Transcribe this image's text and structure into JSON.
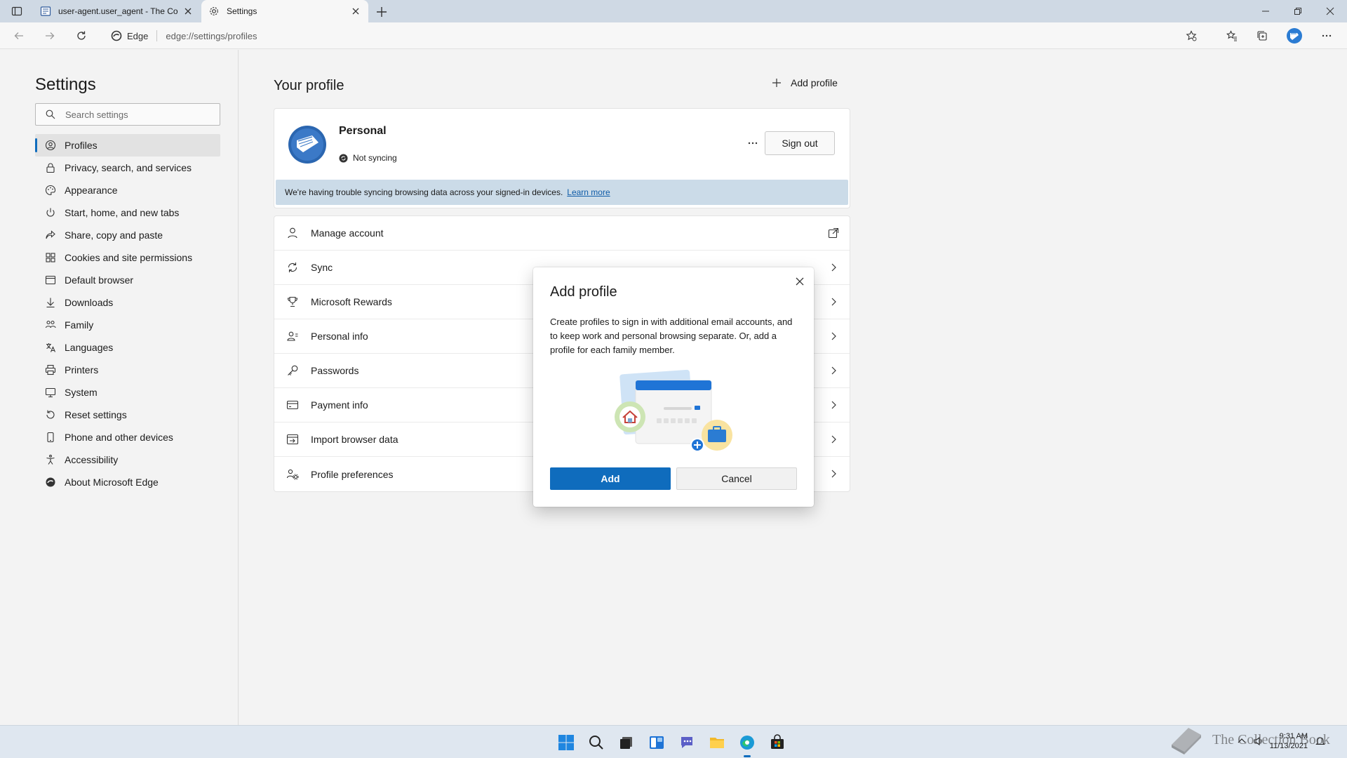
{
  "browser": {
    "tabs": [
      {
        "title": "user-agent.user_agent - The Coll",
        "active": false,
        "favicon": "book-icon"
      },
      {
        "title": "Settings",
        "active": true,
        "favicon": "gear-icon"
      }
    ],
    "address": {
      "site_label": "Edge",
      "url": "edge://settings/profiles"
    }
  },
  "settings": {
    "title": "Settings",
    "search_placeholder": "Search settings",
    "nav": [
      {
        "label": "Profiles",
        "icon": "profile-icon",
        "active": true
      },
      {
        "label": "Privacy, search, and services",
        "icon": "lock-icon"
      },
      {
        "label": "Appearance",
        "icon": "palette-icon"
      },
      {
        "label": "Start, home, and new tabs",
        "icon": "power-icon"
      },
      {
        "label": "Share, copy and paste",
        "icon": "share-icon"
      },
      {
        "label": "Cookies and site permissions",
        "icon": "grid-icon"
      },
      {
        "label": "Default browser",
        "icon": "browser-icon"
      },
      {
        "label": "Downloads",
        "icon": "download-icon"
      },
      {
        "label": "Family",
        "icon": "family-icon"
      },
      {
        "label": "Languages",
        "icon": "language-icon"
      },
      {
        "label": "Printers",
        "icon": "printer-icon"
      },
      {
        "label": "System",
        "icon": "system-icon"
      },
      {
        "label": "Reset settings",
        "icon": "reset-icon"
      },
      {
        "label": "Phone and other devices",
        "icon": "phone-icon"
      },
      {
        "label": "Accessibility",
        "icon": "accessibility-icon"
      },
      {
        "label": "About Microsoft Edge",
        "icon": "edge-icon"
      }
    ]
  },
  "profile": {
    "heading": "Your profile",
    "add_profile_label": "Add profile",
    "name": "Personal",
    "sync_status": "Not syncing",
    "sign_out_label": "Sign out",
    "warning_text": "We're having trouble syncing browsing data across your signed-in devices.",
    "learn_more": "Learn more",
    "rows": [
      {
        "label": "Manage account",
        "icon": "person-icon",
        "trail": "external-link-icon"
      },
      {
        "label": "Sync",
        "icon": "sync-icon",
        "trail": "chevron-right-icon"
      },
      {
        "label": "Microsoft Rewards",
        "icon": "trophy-icon",
        "trail": "chevron-right-icon"
      },
      {
        "label": "Personal info",
        "icon": "contact-icon",
        "trail": "chevron-right-icon"
      },
      {
        "label": "Passwords",
        "icon": "key-icon",
        "trail": "chevron-right-icon"
      },
      {
        "label": "Payment info",
        "icon": "card-icon",
        "trail": "chevron-right-icon"
      },
      {
        "label": "Import browser data",
        "icon": "import-icon",
        "trail": "chevron-right-icon"
      },
      {
        "label": "Profile preferences",
        "icon": "people-settings-icon",
        "trail": "chevron-right-icon"
      }
    ]
  },
  "dialog": {
    "title": "Add profile",
    "body": "Create profiles to sign in with additional email accounts, and to keep work and personal browsing separate. Or, add a profile for each family member.",
    "add_label": "Add",
    "cancel_label": "Cancel"
  },
  "taskbar": {
    "time": "9:31 AM",
    "date": "11/13/2021",
    "watermark": "The Collection Book"
  },
  "colors": {
    "accent": "#0f6cbd",
    "warning_bg": "#cbdbe8"
  }
}
